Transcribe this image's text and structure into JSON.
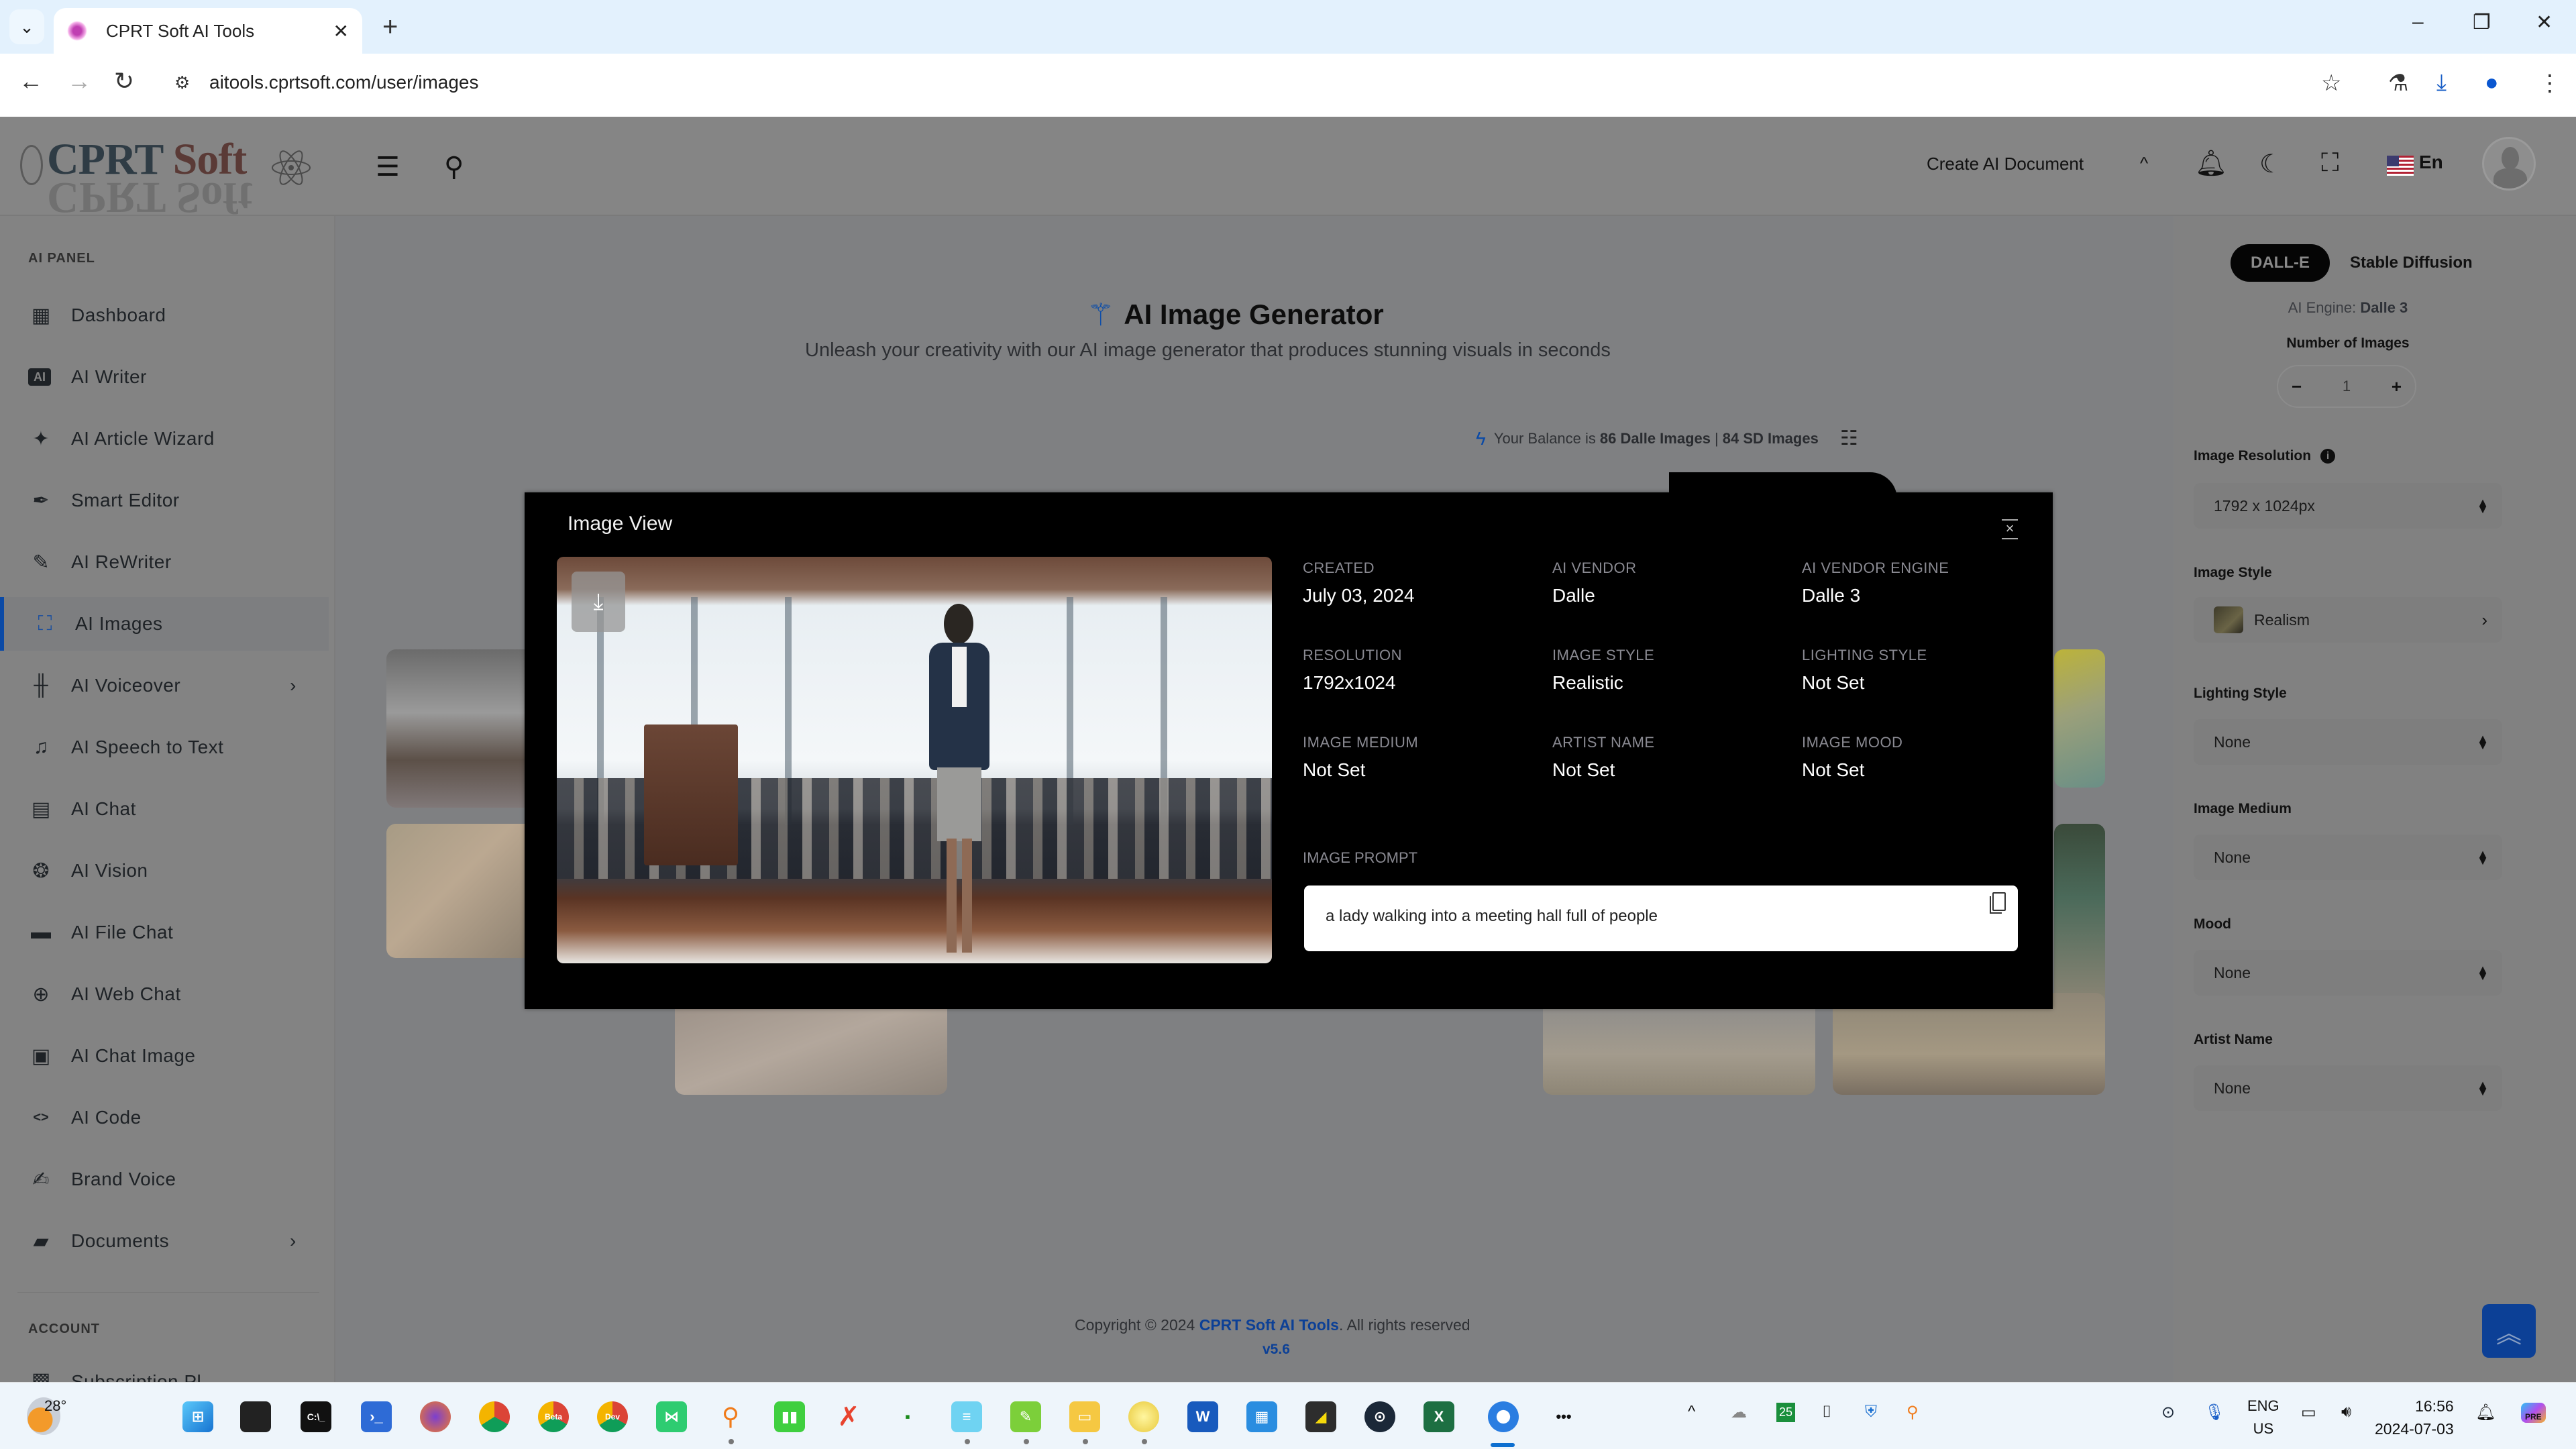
{
  "browser": {
    "tab_title": "CPRT Soft AI Tools",
    "url": "aitools.cprtsoft.com/user/images",
    "icons": [
      "tab-list-chevron-icon",
      "close-icon",
      "plus-icon",
      "minimize-icon",
      "restore-icon",
      "window-close-icon",
      "back-icon",
      "forward-icon",
      "reload-icon",
      "site-info-icon",
      "star-icon",
      "flask-icon",
      "download-icon",
      "profile-icon",
      "more-vert-icon"
    ]
  },
  "header": {
    "logo_text_1": "CPRT",
    "logo_text_2": "Soft",
    "create_doc_label": "Create AI Document",
    "language": "En",
    "icons": [
      "menu-icon",
      "search-icon",
      "chevron-up-icon",
      "bell-icon",
      "moon-icon",
      "fullscreen-icon",
      "us-flag-icon",
      "avatar-icon"
    ]
  },
  "sidebar": {
    "section_ai": "AI PANEL",
    "items": [
      {
        "label": "Dashboard",
        "icon": "dashboard-icon"
      },
      {
        "label": "AI Writer",
        "icon": "ai-chip-icon"
      },
      {
        "label": "AI Article Wizard",
        "icon": "sparkles-icon"
      },
      {
        "label": "Smart Editor",
        "icon": "feather-icon"
      },
      {
        "label": "AI ReWriter",
        "icon": "pen-icon"
      },
      {
        "label": "AI Images",
        "icon": "image-scan-icon",
        "active": true
      },
      {
        "label": "AI Voiceover",
        "icon": "waveform-icon",
        "has_submenu": true
      },
      {
        "label": "AI Speech to Text",
        "icon": "music-folder-icon"
      },
      {
        "label": "AI Chat",
        "icon": "chat-icon"
      },
      {
        "label": "AI Vision",
        "icon": "brain-icon"
      },
      {
        "label": "AI File Chat",
        "icon": "folder-dots-icon"
      },
      {
        "label": "AI Web Chat",
        "icon": "globe-icon"
      },
      {
        "label": "AI Chat Image",
        "icon": "picture-icon"
      },
      {
        "label": "AI Code",
        "icon": "code-icon"
      },
      {
        "label": "Brand Voice",
        "icon": "signature-icon"
      },
      {
        "label": "Documents",
        "icon": "bookmark-folder-icon",
        "has_submenu": true
      }
    ],
    "section_account": "ACCOUNT",
    "clipped_item": "Subscription Pl"
  },
  "main": {
    "title": "AI Image Generator",
    "subtitle": "Unleash your creativity with our AI image generator that produces stunning visuals in seconds",
    "balance_prefix": "Your Balance is",
    "balance_dalle": "86 Dalle Images",
    "balance_sep": "|",
    "balance_sd": "84 SD Images",
    "footer_copyright": "Copyright © 2024",
    "footer_brand": "CPRT Soft AI Tools",
    "footer_rights": ". All rights reserved",
    "footer_version": "v5.6"
  },
  "right_panel": {
    "tabs": [
      {
        "label": "DALL-E",
        "active": true
      },
      {
        "label": "Stable Diffusion",
        "active": false
      }
    ],
    "engine_label": "AI Engine:",
    "engine_value": "Dalle 3",
    "num_images_label": "Number of Images",
    "num_images_value": "1",
    "fields": [
      {
        "label": "Image Resolution",
        "value": "1792 x 1024px",
        "has_info": true
      },
      {
        "label": "Image Style",
        "value": "Realism"
      },
      {
        "label": "Lighting Style",
        "value": "None"
      },
      {
        "label": "Image Medium",
        "value": "None"
      },
      {
        "label": "Mood",
        "value": "None"
      },
      {
        "label": "Artist Name",
        "value": "None"
      }
    ]
  },
  "modal": {
    "title": "Image View",
    "meta": [
      {
        "key": "CREATED",
        "value": "July 03, 2024"
      },
      {
        "key": "AI VENDOR",
        "value": "Dalle"
      },
      {
        "key": "AI VENDOR ENGINE",
        "value": "Dalle 3"
      },
      {
        "key": "RESOLUTION",
        "value": "1792x1024"
      },
      {
        "key": "IMAGE STYLE",
        "value": "Realistic"
      },
      {
        "key": "LIGHTING STYLE",
        "value": "Not Set"
      },
      {
        "key": "IMAGE MEDIUM",
        "value": "Not Set"
      },
      {
        "key": "ARTIST NAME",
        "value": "Not Set"
      },
      {
        "key": "IMAGE MOOD",
        "value": "Not Set"
      }
    ],
    "prompt_label": "IMAGE PROMPT",
    "prompt_text": "a lady walking into a meeting hall full of people",
    "image_alt": "woman in business suit walking into a meeting hall with seated audience and wooden podium"
  },
  "taskbar": {
    "temperature": "28°",
    "lang_line1": "ENG",
    "lang_line2": "US",
    "time": "16:56",
    "date": "2024-07-03",
    "tray_badge": "25",
    "copilot_badge": "PRE"
  },
  "colors": {
    "accent": "#0c4096",
    "modal_bg": "#000000",
    "overlay_dim": "#7f8082"
  }
}
